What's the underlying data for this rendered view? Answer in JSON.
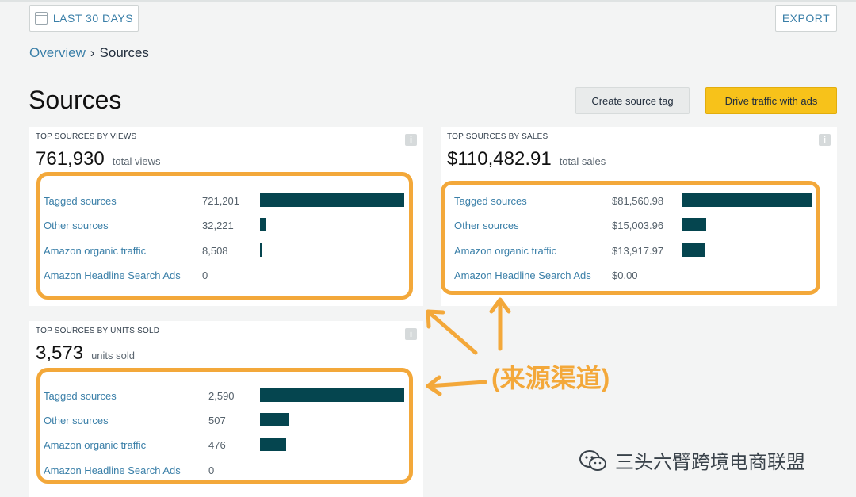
{
  "header": {
    "date_range_label": "LAST 30 DAYS",
    "export_label": "EXPORT"
  },
  "breadcrumb": {
    "root": "Overview",
    "separator": "›",
    "current": "Sources"
  },
  "page": {
    "title": "Sources",
    "create_tag_label": "Create source tag",
    "drive_traffic_label": "Drive traffic with ads"
  },
  "colors": {
    "accent_link": "#3a7fa8",
    "bar": "#05454f",
    "primary_button": "#f7c21a",
    "annotation": "#f3a83a"
  },
  "cards": {
    "views": {
      "label": "TOP SOURCES BY VIEWS",
      "total_value": "761,930",
      "total_unit": "total views",
      "max": 721201,
      "rows": [
        {
          "label": "Tagged sources",
          "value": "721,201",
          "amount": 721201
        },
        {
          "label": "Other sources",
          "value": "32,221",
          "amount": 32221
        },
        {
          "label": "Amazon organic traffic",
          "value": "8,508",
          "amount": 8508
        },
        {
          "label": "Amazon Headline Search Ads",
          "value": "0",
          "amount": 0
        }
      ]
    },
    "sales": {
      "label": "TOP SOURCES BY SALES",
      "total_value": "$110,482.91",
      "total_unit": "total sales",
      "max": 81560.98,
      "rows": [
        {
          "label": "Tagged sources",
          "value": "$81,560.98",
          "amount": 81560.98
        },
        {
          "label": "Other sources",
          "value": "$15,003.96",
          "amount": 15003.96
        },
        {
          "label": "Amazon organic traffic",
          "value": "$13,917.97",
          "amount": 13917.97
        },
        {
          "label": "Amazon Headline Search Ads",
          "value": "$0.00",
          "amount": 0
        }
      ]
    },
    "units": {
      "label": "TOP SOURCES BY UNITS SOLD",
      "total_value": "3,573",
      "total_unit": "units sold",
      "max": 2590,
      "rows": [
        {
          "label": "Tagged sources",
          "value": "2,590",
          "amount": 2590
        },
        {
          "label": "Other sources",
          "value": "507",
          "amount": 507
        },
        {
          "label": "Amazon organic traffic",
          "value": "476",
          "amount": 476
        },
        {
          "label": "Amazon Headline Search Ads",
          "value": "0",
          "amount": 0
        }
      ]
    }
  },
  "annotation": {
    "text": "(来源渠道)"
  },
  "watermark": {
    "icon": "wechat-icon",
    "text": "三头六臂跨境电商联盟"
  }
}
